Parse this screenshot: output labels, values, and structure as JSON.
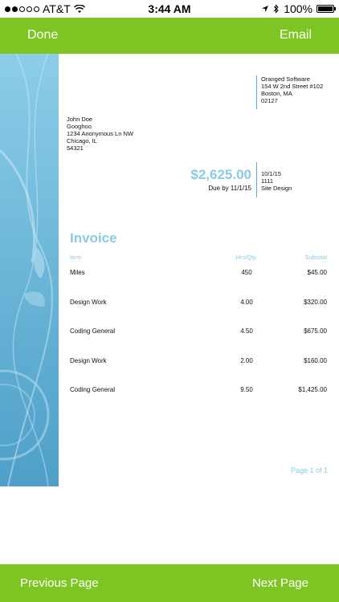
{
  "status_bar": {
    "carrier": "AT&T",
    "time": "3:44 AM",
    "battery": "100%"
  },
  "topbar": {
    "done_label": "Done",
    "email_label": "Email"
  },
  "invoice": {
    "company": {
      "name": "Oranged Software",
      "street": "154 W 2nd Street #102",
      "city": "Boston, MA",
      "zip": "02127"
    },
    "bill_to": {
      "name": "John Doe",
      "company": "Googhoo",
      "street": "1234 Anonymous Ln NW",
      "city": "Chicago, IL",
      "zip": "54321"
    },
    "amount": "$2,625.00",
    "due": "Due by 11/1/15",
    "meta": {
      "date": "10/1/15",
      "number": "1111",
      "project": "Site Design"
    },
    "title": "Invoice",
    "columns": {
      "item": "Item",
      "hrs": "Hrs/Qty.",
      "subtotal": "Subtotal"
    },
    "rows": [
      {
        "item": "Miles",
        "hrs": "450",
        "subtotal": "$45.00"
      },
      {
        "item": "Design Work",
        "hrs": "4.00",
        "subtotal": "$320.00"
      },
      {
        "item": "Coding General",
        "hrs": "4.50",
        "subtotal": "$675.00"
      },
      {
        "item": "Design Work",
        "hrs": "2.00",
        "subtotal": "$160.00"
      },
      {
        "item": "Coding General",
        "hrs": "9.50",
        "subtotal": "$1,425.00"
      }
    ],
    "page_label": "Page 1 of 1"
  },
  "bottombar": {
    "prev_label": "Previous Page",
    "next_label": "Next Page"
  },
  "colors": {
    "bar_green": "#7dc522",
    "accent_blue": "#8bcbe8",
    "art_blue": "#5aa9d4"
  }
}
